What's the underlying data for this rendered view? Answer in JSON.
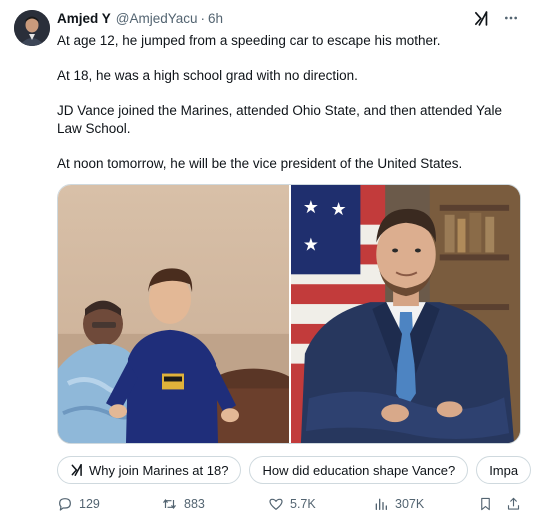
{
  "tweet": {
    "author": {
      "name": "Amjed Y",
      "handle": "@AmjedYacu",
      "separator": "·",
      "time": "6h"
    },
    "paragraphs": [
      "At age 12, he jumped from a speeding car to escape his mother.",
      "At 18, he was a high school grad with no direction.",
      "JD Vance joined the Marines, attended Ohio State, and then attended Yale Law School.",
      "At noon tomorrow, he will be the vice president of the United States."
    ],
    "media": {
      "left_photo": "childhood-photo",
      "right_photo": "official-portrait"
    },
    "grok_suggestions": [
      "Why join Marines at 18?",
      "How did education shape Vance?",
      "Impa"
    ],
    "actions": {
      "replies": "129",
      "reposts": "883",
      "likes": "5.7K",
      "views": "307K"
    }
  },
  "colors": {
    "text": "#0f1419",
    "secondary": "#536471",
    "border": "#cfd9de"
  },
  "icons": [
    "grok-icon",
    "more-icon",
    "reply-icon",
    "repost-icon",
    "like-icon",
    "views-icon",
    "bookmark-icon",
    "share-icon"
  ]
}
